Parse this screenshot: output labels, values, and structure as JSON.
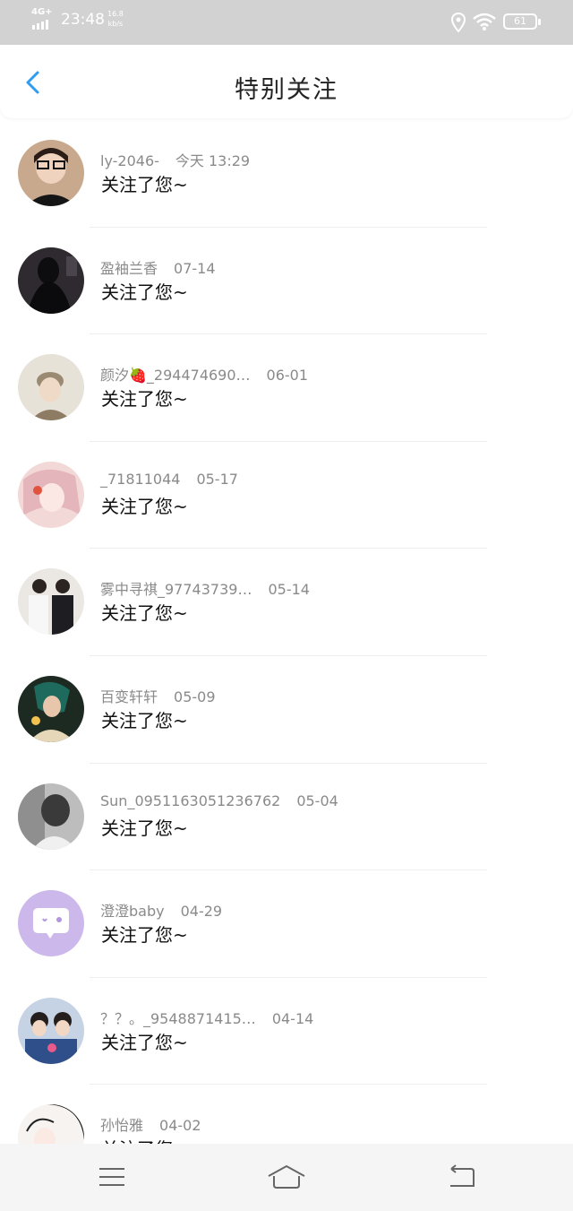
{
  "status_bar": {
    "network": "4G+",
    "time": "23:48",
    "speed_value": "16.8",
    "speed_unit": "kb/s",
    "battery": "61"
  },
  "header": {
    "title": "特别关注",
    "back_icon": "chevron-left-icon"
  },
  "colors": {
    "accent": "#2f9cf0",
    "status_bar_bg": "#d2d2d2",
    "muted_text": "#8a8a8a"
  },
  "items": [
    {
      "name": "ly-2046-",
      "date": "今天 13:29",
      "message": "关注了您~"
    },
    {
      "name": "盈袖兰香",
      "date": "07-14",
      "message": "关注了您~"
    },
    {
      "name": "颜汐🍓_294474690…",
      "date": "06-01",
      "message": "关注了您~"
    },
    {
      "name": "_71811044",
      "date": "05-17",
      "message": "关注了您~"
    },
    {
      "name": "雾中寻祺_97743739…",
      "date": "05-14",
      "message": "关注了您~"
    },
    {
      "name": "百变轩轩",
      "date": "05-09",
      "message": "关注了您~"
    },
    {
      "name": "Sun_0951163051236762",
      "date": "05-04",
      "message": "关注了您~"
    },
    {
      "name": "澄澄baby",
      "date": "04-29",
      "message": "关注了您~"
    },
    {
      "name": "？？。_9548871415…",
      "date": "04-14",
      "message": "关注了您~"
    },
    {
      "name": "孙怡雅",
      "date": "04-02",
      "message": "关注了您~"
    }
  ],
  "system_nav": {
    "menu_icon": "menu-icon",
    "home_icon": "home-icon",
    "back_icon": "back-arrow-icon"
  }
}
